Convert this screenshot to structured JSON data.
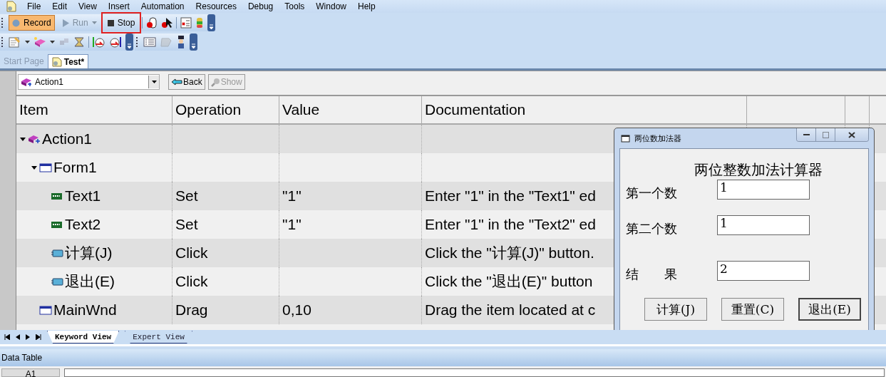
{
  "menu": [
    "File",
    "Edit",
    "View",
    "Insert",
    "Automation",
    "Resources",
    "Debug",
    "Tools",
    "Window",
    "Help"
  ],
  "toolbar": [
    {
      "label": "Record",
      "kind": "record",
      "selected": true,
      "disabled": false,
      "highlighted": false
    },
    {
      "label": "Run",
      "kind": "run",
      "selected": false,
      "disabled": true,
      "highlighted": false
    },
    {
      "label": "Stop",
      "kind": "stop",
      "selected": false,
      "disabled": false,
      "highlighted": true
    }
  ],
  "document_tabs": [
    {
      "label": "Start Page",
      "selected": false
    },
    {
      "label": "Test*",
      "selected": true
    }
  ],
  "action_selector": {
    "value": "Action1"
  },
  "nav_buttons": [
    {
      "label": "Back",
      "disabled": false
    },
    {
      "label": "Show",
      "disabled": true
    }
  ],
  "table": {
    "columns": [
      "Item",
      "Operation",
      "Value",
      "Documentation"
    ],
    "rows": [
      {
        "item": "Action1",
        "kind": "action",
        "expanded": true,
        "children": [
          {
            "item": "Form1",
            "kind": "window",
            "expanded": true,
            "children": [
              {
                "item": "Text1",
                "kind": "edit",
                "operation": "Set",
                "value": "\"1\"",
                "documentation": "Enter \"1\" in the \"Text1\" ed"
              },
              {
                "item": "Text2",
                "kind": "edit",
                "operation": "Set",
                "value": "\"1\"",
                "documentation": "Enter \"1\" in the \"Text2\" ed"
              },
              {
                "item": "计算(J)",
                "kind": "button",
                "operation": "Click",
                "documentation": "Click the \"计算(J)\" button."
              },
              {
                "item": "退出(E)",
                "kind": "button",
                "operation": "Click",
                "documentation": "Click the \"退出(E)\" button"
              }
            ]
          },
          {
            "item": "MainWnd",
            "kind": "window",
            "operation": "Drag",
            "value": "0,10",
            "documentation": "Drag the item located at c"
          }
        ]
      }
    ]
  },
  "view_tabs": [
    {
      "label": "Keyword View",
      "selected": true
    },
    {
      "label": "Expert View",
      "selected": false
    }
  ],
  "data_table": {
    "title": "Data Table",
    "cell": "A1"
  },
  "dialog": {
    "title": "两位数加法器",
    "heading": "两位整数加法计算器",
    "fields": [
      {
        "label": "第一个数",
        "value": "1"
      },
      {
        "label": "第二个数",
        "value": "1"
      },
      {
        "label": "结　　果",
        "value": "2"
      }
    ],
    "buttons": [
      {
        "label": "计算(J)",
        "focused": false
      },
      {
        "label": "重置(C)",
        "focused": false
      },
      {
        "label": "退出(E)",
        "focused": true
      }
    ]
  }
}
